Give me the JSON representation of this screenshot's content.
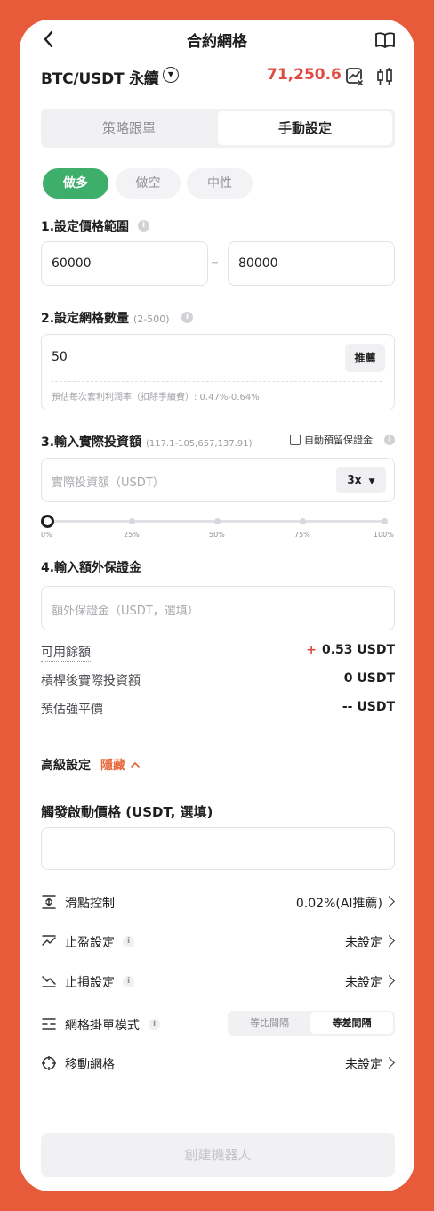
{
  "header": {
    "title": "合約網格"
  },
  "ticker": {
    "pair": "BTC/USDT 永續",
    "price": "71,250.6"
  },
  "mode_tabs": {
    "follow": "策略跟單",
    "manual": "手動設定"
  },
  "direction": {
    "long": "做多",
    "short": "做空",
    "neutral": "中性"
  },
  "price_range": {
    "label": "1.設定價格範圍",
    "lower": "60000",
    "separator": "~",
    "upper": "80000"
  },
  "grid_count": {
    "label": "2.設定網格數量",
    "range": "(2-500)",
    "value": "50",
    "recommend": "推薦",
    "profit_rate": "預估每次套利利潤率（扣除手續費）: 0.47%-0.64%"
  },
  "investment": {
    "label": "3.輸入實際投資額",
    "range": "(117.1-105,657,137.91)",
    "auto_reserve": "自動預留保證金",
    "placeholder": "實際投資額（USDT）",
    "leverage": "3x",
    "slider_percent": 0,
    "ticks": [
      "0%",
      "25%",
      "50%",
      "75%",
      "100%"
    ]
  },
  "margin": {
    "label": "4.輸入額外保證金",
    "placeholder": "額外保證金（USDT，選填）"
  },
  "summary": {
    "available_label": "可用餘額",
    "available_value": "0.53 USDT",
    "plus": "+",
    "leveraged_label": "槓桿後實際投資額",
    "leveraged_value": "0 USDT",
    "liq_label": "預估強平價",
    "liq_value": "-- USDT"
  },
  "advanced": {
    "label": "高級設定",
    "toggle": "隱藏",
    "trigger_label": "觸發啟動價格 (USDT, 選填)",
    "trigger_value": "",
    "slippage_label": "滑點控制",
    "slippage_value": "0.02%(AI推薦)",
    "tp_label": "止盈設定",
    "tp_value": "未設定",
    "sl_label": "止損設定",
    "sl_value": "未設定",
    "order_mode_label": "網格掛單模式",
    "order_mode_a": "等比間隔",
    "order_mode_b": "等差間隔",
    "move_label": "移動網格",
    "move_value": "未設定"
  },
  "submit": {
    "label": "創建機器人"
  },
  "colors": {
    "accent_green": "#3EAE6B",
    "price_red": "#E04A43",
    "background": "#E85B3A"
  }
}
